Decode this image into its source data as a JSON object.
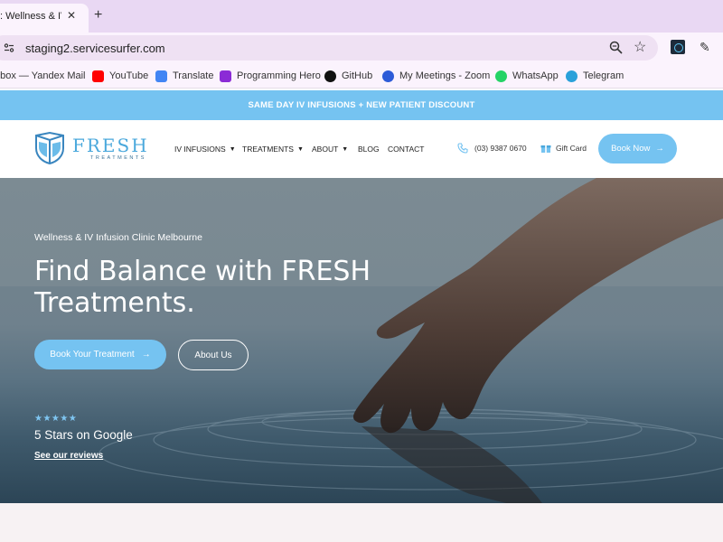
{
  "browser": {
    "tab": {
      "title": ": Wellness & IV",
      "close": "✕"
    },
    "new_tab": "+",
    "url": "staging2.servicesurfer.com",
    "bookmarks": [
      {
        "label": "nbox — Yandex Mail",
        "icon": "mail-icon",
        "color": "#ffffff"
      },
      {
        "label": "YouTube",
        "icon": "youtube-icon",
        "color": "#ff0000"
      },
      {
        "label": "Translate",
        "icon": "translate-icon",
        "color": "#4285f4"
      },
      {
        "label": "Programming Hero",
        "icon": "programming-hero-icon",
        "color": "#8b2bd6"
      },
      {
        "label": "GitHub",
        "icon": "github-icon",
        "color": "#111111"
      },
      {
        "label": "My Meetings - Zoom",
        "icon": "zoom-icon",
        "color": "#2d5bd8"
      },
      {
        "label": "WhatsApp",
        "icon": "whatsapp-icon",
        "color": "#25d366"
      },
      {
        "label": "Telegram",
        "icon": "telegram-icon",
        "color": "#2aa1da"
      }
    ]
  },
  "promo": {
    "text": "SAME DAY IV INFUSIONS + NEW PATIENT DISCOUNT"
  },
  "header": {
    "logo": {
      "word": "FRESH",
      "sub": "TREATMENTS"
    },
    "nav": [
      {
        "label": "IV INFUSIONS",
        "dropdown": true
      },
      {
        "label": "TREATMENTS",
        "dropdown": true
      },
      {
        "label": "ABOUT",
        "dropdown": true
      },
      {
        "label": "BLOG",
        "dropdown": false
      },
      {
        "label": "CONTACT",
        "dropdown": false
      }
    ],
    "phone": "(03) 9387 0670",
    "gift_card": "Gift Card",
    "book_now": "Book Now",
    "arrow": "→"
  },
  "hero": {
    "eyebrow": "Wellness & IV Infusion Clinic Melbourne",
    "title": "Find Balance with FRESH Treatments.",
    "cta": "Book Your Treatment",
    "about": "About Us",
    "stars": "★★★★★",
    "rating": "5 Stars on Google",
    "reviews_link": "See our reviews"
  },
  "colors": {
    "accent": "#75c3f1",
    "tabstrip": "#e9d8f3",
    "logo": "#4aa8dc"
  }
}
